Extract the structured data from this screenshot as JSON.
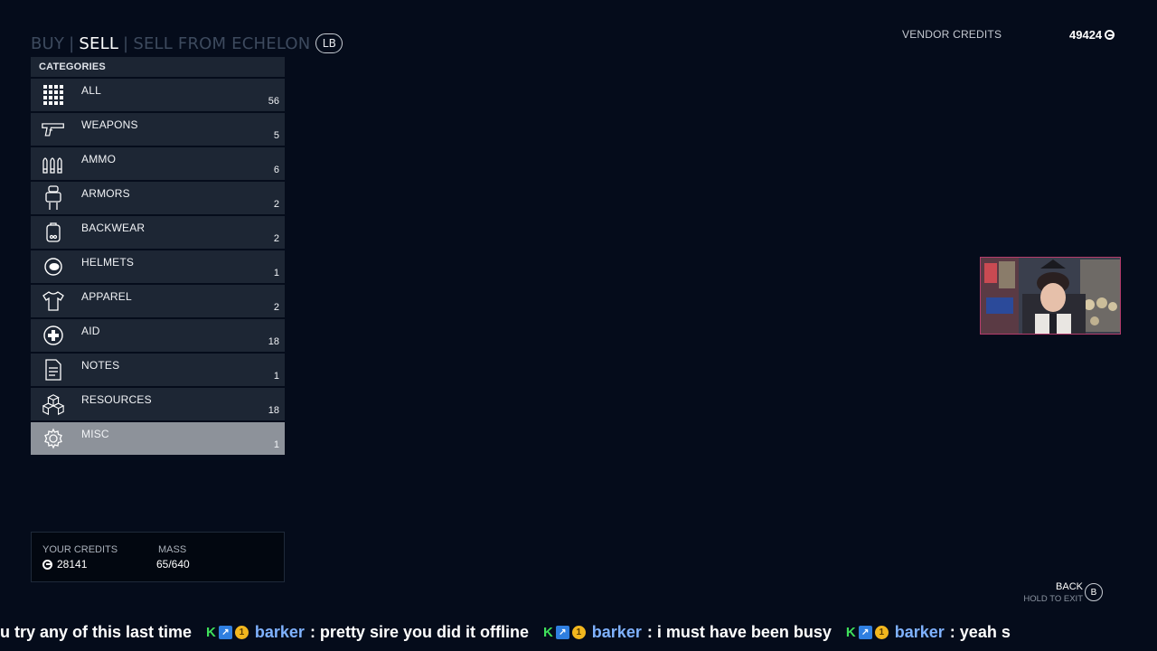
{
  "tabs": [
    "BUY",
    "SELL",
    "SELL FROM ECHELON"
  ],
  "tab_hint": "LB",
  "vendor": {
    "label": "VENDOR CREDITS",
    "value": "49424"
  },
  "categories_header": "CATEGORIES",
  "categories": [
    {
      "label": "ALL",
      "count": "56",
      "icon": "grid-icon"
    },
    {
      "label": "WEAPONS",
      "count": "5",
      "icon": "pistol-icon"
    },
    {
      "label": "AMMO",
      "count": "6",
      "icon": "ammo-icon"
    },
    {
      "label": "ARMORS",
      "count": "2",
      "icon": "armor-icon"
    },
    {
      "label": "BACKWEAR",
      "count": "2",
      "icon": "backpack-icon"
    },
    {
      "label": "HELMETS",
      "count": "1",
      "icon": "helmet-icon"
    },
    {
      "label": "APPAREL",
      "count": "2",
      "icon": "shirt-icon"
    },
    {
      "label": "AID",
      "count": "18",
      "icon": "medkit-icon"
    },
    {
      "label": "NOTES",
      "count": "1",
      "icon": "note-icon"
    },
    {
      "label": "RESOURCES",
      "count": "18",
      "icon": "resource-cubes-icon"
    },
    {
      "label": "MISC",
      "count": "1",
      "icon": "gear-icon",
      "selected": true
    }
  ],
  "footer": {
    "credits_label": "YOUR CREDITS",
    "credits_value": "28141",
    "mass_label": "MASS",
    "mass_value": "65/640"
  },
  "back": {
    "label": "BACK",
    "sub": "HOLD TO EXIT",
    "button": "B"
  },
  "ticker": {
    "lead": "u try any of this last time",
    "messages": [
      {
        "user": "barker",
        "text": ": pretty sire you did it offline"
      },
      {
        "user": "barker",
        "text": ": i must have been busy"
      },
      {
        "user": "barker",
        "text": ": yeah s"
      }
    ]
  },
  "colors": {
    "background": "#050c1b",
    "row": "#1d2634",
    "row_selected": "#8d929a",
    "chat_user": "#7fb2ff"
  }
}
